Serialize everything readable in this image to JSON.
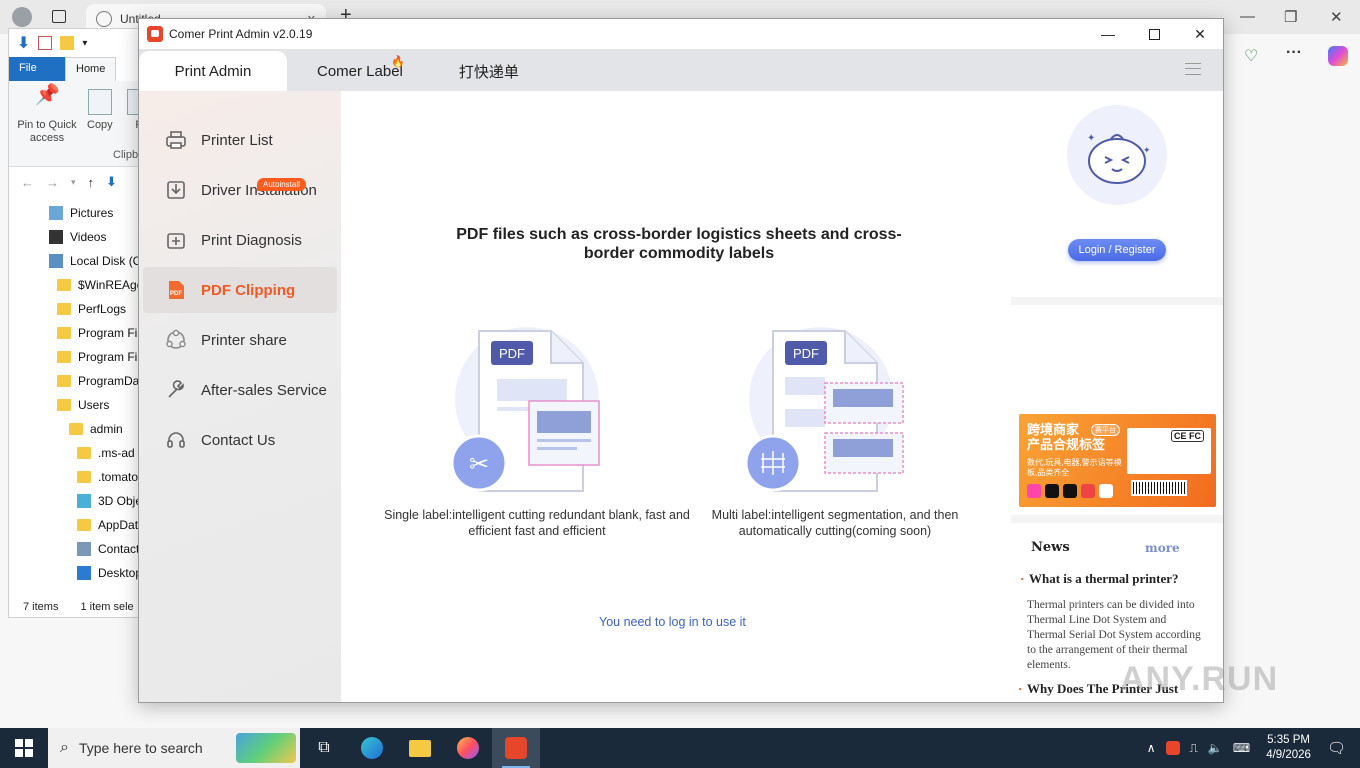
{
  "browser": {
    "tab_title": "Untitled",
    "new_tab": "+",
    "min": "—",
    "restore": "❐",
    "close": "✕",
    "more": "···"
  },
  "explorer": {
    "tabs": {
      "file": "File",
      "home": "Home"
    },
    "ribbon": {
      "pin": "Pin to Quick access",
      "copy": "Copy",
      "paste": "P",
      "group": "Clipb"
    },
    "tree": [
      {
        "label": "Pictures",
        "icon": "pictures-icon",
        "indent": 0
      },
      {
        "label": "Videos",
        "icon": "videos-icon",
        "indent": 0
      },
      {
        "label": "Local Disk (C",
        "icon": "drive-icon",
        "indent": 0
      },
      {
        "label": "$WinREAge",
        "icon": "folder-icon",
        "indent": 1
      },
      {
        "label": "PerfLogs",
        "icon": "folder-icon",
        "indent": 1
      },
      {
        "label": "Program Fil",
        "icon": "folder-icon",
        "indent": 1
      },
      {
        "label": "Program Fil",
        "icon": "folder-icon",
        "indent": 1
      },
      {
        "label": "ProgramDa",
        "icon": "folder-icon",
        "indent": 1
      },
      {
        "label": "Users",
        "icon": "folder-icon",
        "indent": 1
      },
      {
        "label": "admin",
        "icon": "folder-icon",
        "indent": 2
      },
      {
        "label": ".ms-ad",
        "icon": "folder-icon",
        "indent": 3
      },
      {
        "label": ".tomato-",
        "icon": "folder-icon",
        "indent": 3
      },
      {
        "label": "3D Objec",
        "icon": "3d-objects-icon",
        "indent": 3
      },
      {
        "label": "AppData",
        "icon": "folder-icon",
        "indent": 3
      },
      {
        "label": "Contacts",
        "icon": "contacts-icon",
        "indent": 3
      },
      {
        "label": "Desktop",
        "icon": "desktop-icon",
        "indent": 3
      }
    ],
    "status_items": "7 items",
    "status_selected": "1 item sele"
  },
  "app": {
    "title": "Comer Print Admin v2.0.19",
    "tabs": [
      "Print Admin",
      "Comer Label",
      "打快递单"
    ],
    "nav": [
      {
        "label": "Printer List",
        "icon": "printer-icon"
      },
      {
        "label": "Driver Installation",
        "icon": "driver-install-icon"
      },
      {
        "label": "Print Diagnosis",
        "icon": "diagnosis-icon"
      },
      {
        "label": "PDF Clipping",
        "icon": "pdf-icon"
      },
      {
        "label": "Printer share",
        "icon": "share-icon"
      },
      {
        "label": "After-sales Service",
        "icon": "wrench-icon"
      },
      {
        "label": "Contact Us",
        "icon": "headset-icon"
      }
    ],
    "badge": "Autoinstall",
    "headline": "PDF files such as cross-border logistics sheets and cross-border commodity labels",
    "cards": [
      {
        "pdf_tag": "PDF",
        "caption": "Single label:intelligent cutting redundant blank, fast and efficient fast and efficient"
      },
      {
        "pdf_tag": "PDF",
        "caption": "Multi label:intelligent segmentation, and then automatically cutting(coming soon)"
      }
    ],
    "login_msg": "You need to log in to use it",
    "login_btn": "Login / Register",
    "banner": {
      "title_line1": "跨境商家",
      "tag": "赛平台",
      "title_line2": "产品合规标签",
      "subtitle": "数代,玩具,电器,警示语等模板,品类齐全",
      "cert": "CE FC"
    },
    "news": {
      "title": "News",
      "more": "more",
      "items": [
        {
          "headline": "What is a thermal printer?",
          "body": "Thermal printers can be divided into Thermal Line Dot System and Thermal Serial Dot System according to the arrangement of their thermal elements."
        },
        {
          "headline": "Why Does The Printer Just",
          "body": ""
        }
      ]
    }
  },
  "watermark": "ANY.RUN",
  "taskbar": {
    "search_placeholder": "Type here to search",
    "time": "5:35 PM",
    "date": "4/9/2026"
  },
  "colors": {
    "accent": "#f05a24",
    "link": "#3b64c4",
    "login": "#4a6be6"
  }
}
